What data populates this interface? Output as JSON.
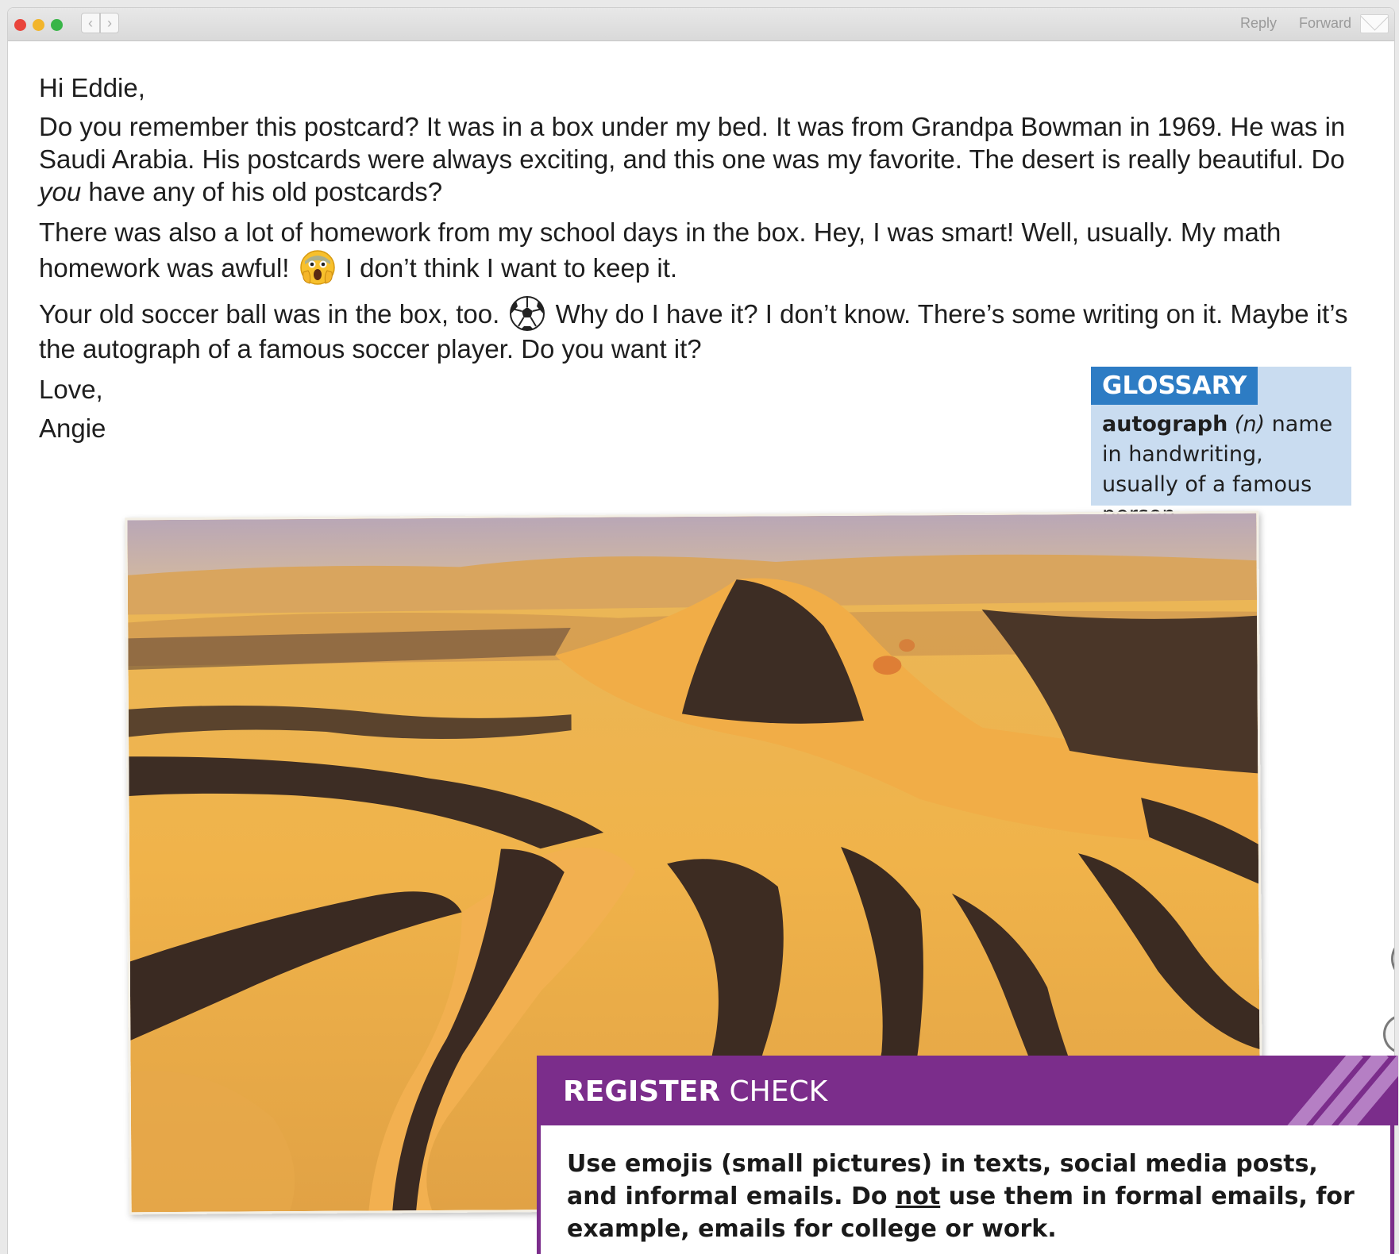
{
  "window": {
    "toolbar": {
      "reply_label": "Reply",
      "forward_label": "Forward",
      "back_glyph": "‹",
      "forward_glyph": "›"
    },
    "traffic_lights": {
      "close_color": "#e9443b",
      "minimize_color": "#f2b52b",
      "zoom_color": "#38b547"
    }
  },
  "email": {
    "greeting": "Hi Eddie,",
    "para1": {
      "before": "Do you remember this postcard? It was in a box under my bed. It was from Grandpa Bowman in 1969. He was in Saudi Arabia. His postcards were always exciting, and this one was my favorite. The desert is really beautiful. Do ",
      "emphasis": "you",
      "after": " have any of his old postcards?"
    },
    "para2": {
      "before": "There was also a lot of homework from my school days in the box. Hey, I was smart! Well, usually. My math homework was awful! ",
      "emoji": "shocked-face-emoji",
      "after": " I don’t think I want to keep it."
    },
    "para3": {
      "before": "Your old soccer ball was in the box, too. ",
      "emoji": "soccer-ball-emoji",
      "after": " Why do I have it? I don’t know. There’s some writing on it. Maybe it’s the autograph of a famous soccer player. Do you want it?"
    },
    "closing": "Love,",
    "signature": "Angie"
  },
  "glossary": {
    "heading": "GLOSSARY",
    "term": "autograph",
    "pos": "(n)",
    "definition": " name in handwriting, usually of a famous person",
    "color": "#2d7cc4",
    "background": "#c9dcf0"
  },
  "postcard": {
    "image": "desert-sand-dunes-photo"
  },
  "register_check": {
    "title_bold": "REGISTER",
    "title_light": " CHECK",
    "text_before": "Use emojis (small pictures) in texts, social media posts, and informal emails. Do ",
    "text_underlined": "not",
    "text_after": " use them in formal emails, for example, emails for college or work.",
    "color": "#7b2d8b"
  }
}
